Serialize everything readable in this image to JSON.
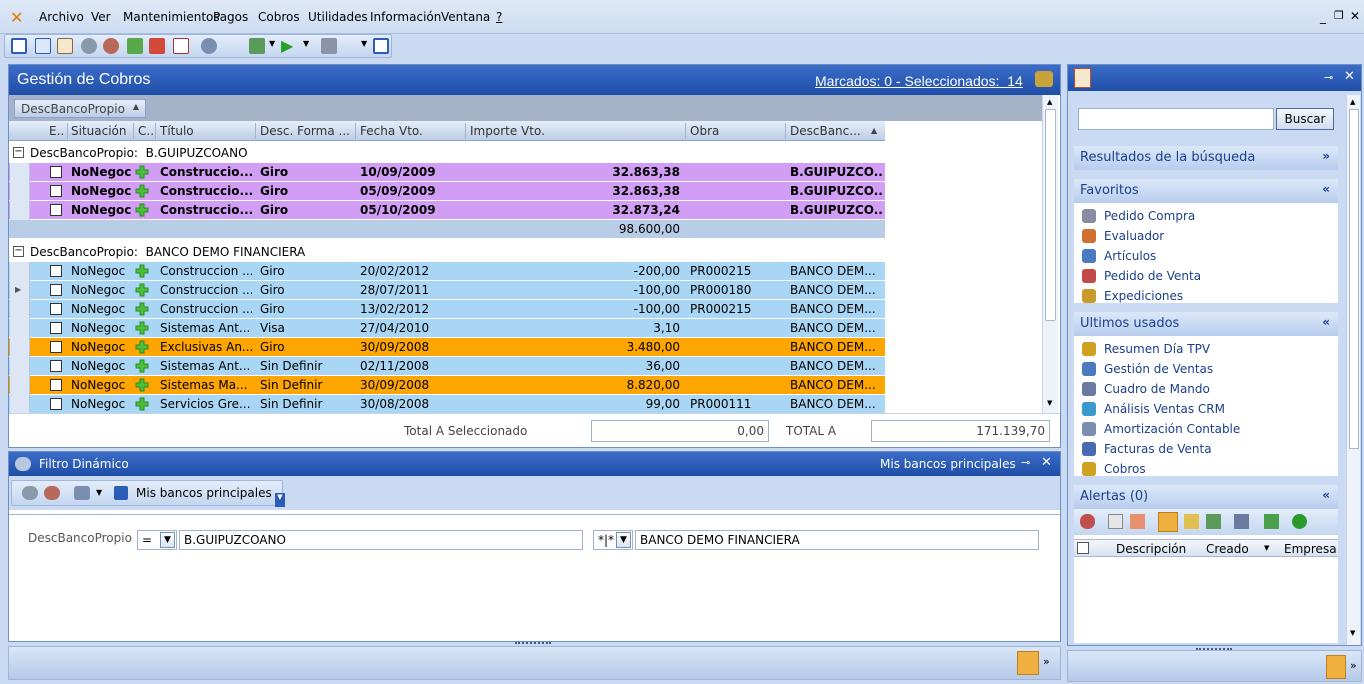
{
  "menu": {
    "items": [
      "Archivo",
      "Ver",
      "Mantenimientos",
      "Pagos",
      "Cobros",
      "Utilidades",
      "Información",
      "Ventana",
      "?"
    ]
  },
  "panel": {
    "title": "Gestión de Cobros",
    "marked_summary": "Marcados: 0 - Seleccionados:  14",
    "group_chip": "DescBancoPropio",
    "columns": [
      "E..",
      "Situación",
      "C..",
      "Título",
      "Desc. Forma ...",
      "Fecha Vto.",
      "Importe Vto.",
      "Obra",
      "DescBanc..."
    ],
    "groups": [
      {
        "label": "DescBancoPropio:  B.GUIPUZCOANO",
        "rows": [
          {
            "situacion": "NoNegoc",
            "titulo": "Construccio...",
            "forma": "Giro",
            "fecha": "10/09/2009",
            "importe": "32.863,38",
            "obra": "",
            "banco": "B.GUIPUZCO...",
            "style": "purple"
          },
          {
            "situacion": "NoNegoc",
            "titulo": "Construccio...",
            "forma": "Giro",
            "fecha": "05/09/2009",
            "importe": "32.863,38",
            "obra": "",
            "banco": "B.GUIPUZCO...",
            "style": "purple"
          },
          {
            "situacion": "NoNegoc",
            "titulo": "Construccio...",
            "forma": "Giro",
            "fecha": "05/10/2009",
            "importe": "32.873,24",
            "obra": "",
            "banco": "B.GUIPUZCO...",
            "style": "purple"
          }
        ],
        "subtotal": "98.600,00"
      },
      {
        "label": "DescBancoPropio:  BANCO DEMO FINANCIERA",
        "rows": [
          {
            "situacion": "NoNegoc",
            "titulo": "Construccion ...",
            "forma": "Giro",
            "fecha": "20/02/2012",
            "importe": "-200,00",
            "obra": "PR000215",
            "banco": "BANCO DEM...",
            "style": "blue"
          },
          {
            "situacion": "NoNegoc",
            "titulo": "Construccion ...",
            "forma": "Giro",
            "fecha": "28/07/2011",
            "importe": "-100,00",
            "obra": "PR000180",
            "banco": "BANCO DEM...",
            "style": "blue"
          },
          {
            "situacion": "NoNegoc",
            "titulo": "Construccion ...",
            "forma": "Giro",
            "fecha": "13/02/2012",
            "importe": "-100,00",
            "obra": "PR000215",
            "banco": "BANCO DEM...",
            "style": "blue"
          },
          {
            "situacion": "NoNegoc",
            "titulo": "Sistemas Ant...",
            "forma": "Visa",
            "fecha": "27/04/2010",
            "importe": "3,10",
            "obra": "",
            "banco": "BANCO DEM...",
            "style": "blue"
          },
          {
            "situacion": "NoNegoc",
            "titulo": "Exclusivas An...",
            "forma": "Giro",
            "fecha": "30/09/2008",
            "importe": "3.480,00",
            "obra": "",
            "banco": "BANCO DEM...",
            "style": "orange"
          },
          {
            "situacion": "NoNegoc",
            "titulo": "Sistemas Ant...",
            "forma": "Sin Definir",
            "fecha": "02/11/2008",
            "importe": "36,00",
            "obra": "",
            "banco": "BANCO DEM...",
            "style": "blue"
          },
          {
            "situacion": "NoNegoc",
            "titulo": "Sistemas Ma...",
            "forma": "Sin Definir",
            "fecha": "30/09/2008",
            "importe": "8.820,00",
            "obra": "",
            "banco": "BANCO DEM...",
            "style": "orange"
          },
          {
            "situacion": "NoNegoc",
            "titulo": "Servicios Gre...",
            "forma": "Sin Definir",
            "fecha": "30/08/2008",
            "importe": "99,00",
            "obra": "PR000111",
            "banco": "BANCO DEM...",
            "style": "blue"
          }
        ]
      }
    ],
    "totals": {
      "selected_label": "Total A Seleccionado",
      "selected_value": "0,00",
      "total_label": "TOTAL A",
      "total_value": "171.139,70"
    }
  },
  "filter": {
    "title": "Filtro Dinámico",
    "preset": "Mis bancos principales",
    "toolbar_label": "Mis bancos principales",
    "field_label": "DescBancoPropio",
    "op1": "=",
    "value1": "B.GUIPUZCOANO",
    "op2": "*|*",
    "value2": "BANCO DEMO FINANCIERA"
  },
  "sidebar": {
    "search_button": "Buscar",
    "search_value": "",
    "results_title": "Resultados de la búsqueda",
    "favorites_title": "Favoritos",
    "favorites": [
      "Pedido Compra",
      "Evaluador",
      "Artículos",
      "Pedido de Venta",
      "Expediciones"
    ],
    "recent_title": "Ultimos usados",
    "recent": [
      "Resumen Día TPV",
      "Gestión de Ventas",
      "Cuadro de Mando",
      "Análisis Ventas CRM",
      "Amortización Contable",
      "Facturas de Venta",
      "Cobros"
    ],
    "alerts_title": "Alertas (0)",
    "alert_columns": [
      "Descripción",
      "Creado",
      "Empresa"
    ]
  },
  "colors": {
    "purple": "#d29df5",
    "blue": "#a9d6f5",
    "orange": "#ffa500",
    "titlebar": "#2a5cb8"
  }
}
